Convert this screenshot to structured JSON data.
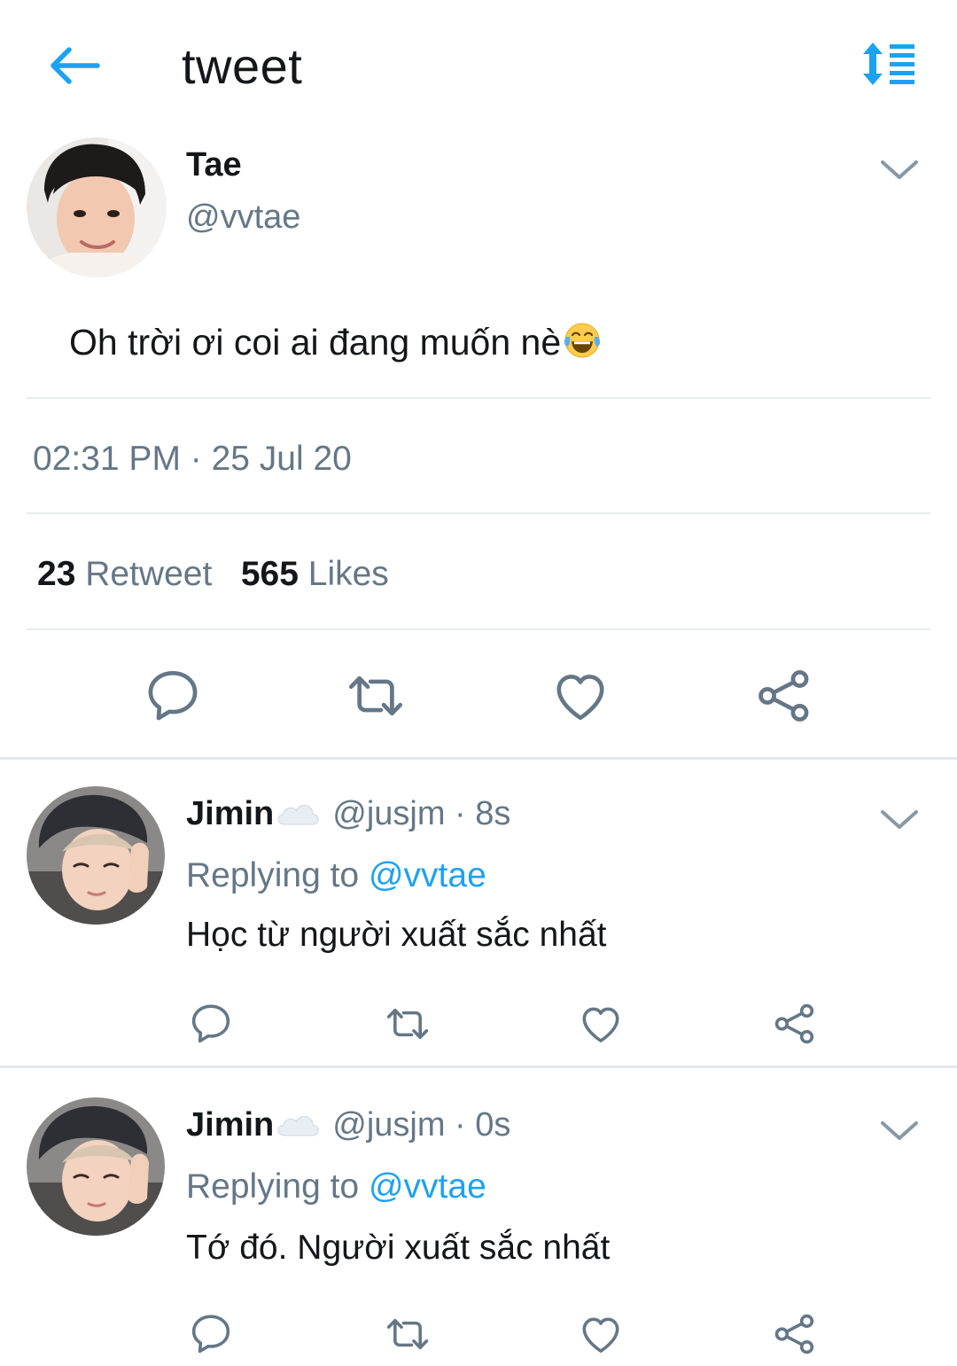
{
  "header": {
    "title": "tweet",
    "back_icon": "arrow-left-icon",
    "sort_icon": "sort-list-icon"
  },
  "colors": {
    "accent": "#1da1f2",
    "text": "#14171a",
    "muted": "#657786",
    "divider": "#e6ecf0",
    "icon": "#657786"
  },
  "tweet": {
    "author_name": "Tae",
    "author_handle": "@vvtae",
    "text": "Oh trời ơi coi ai đang muốn nè",
    "emoji": "face-with-tears-of-joy-icon",
    "timestamp": "02:31 PM · 25 Jul 20",
    "retweet_count": "23",
    "retweet_label": "Retweet",
    "like_count": "565",
    "like_label": "Likes"
  },
  "replies": [
    {
      "name": "Jimin",
      "name_icon": "cloud-icon",
      "meta": "@jusjm · 8s",
      "replying_label": "Replying to",
      "replying_to": "@vvtae",
      "text": "Học từ người xuất sắc nhất"
    },
    {
      "name": "Jimin",
      "name_icon": "cloud-icon",
      "meta": "@jusjm · 0s",
      "replying_label": "Replying to",
      "replying_to": "@vvtae",
      "text": "Tớ đó. Người xuất sắc nhất"
    }
  ]
}
